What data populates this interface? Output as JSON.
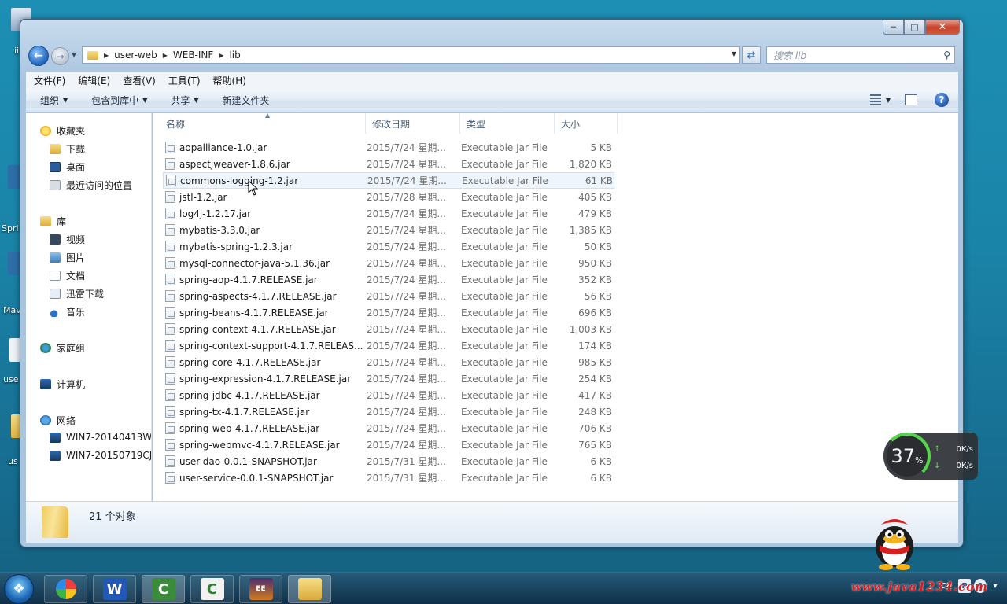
{
  "desktop": {
    "labels": [
      "ii",
      "Spri",
      "Mav",
      "use",
      "us"
    ]
  },
  "address": {
    "parts": [
      "user-web",
      "WEB-INF",
      "lib"
    ],
    "search_placeholder": "搜索 lib"
  },
  "menu": [
    "文件(F)",
    "编辑(E)",
    "查看(V)",
    "工具(T)",
    "帮助(H)"
  ],
  "toolbar": {
    "organize": "组织",
    "include_library": "包含到库中",
    "share": "共享",
    "new_folder": "新建文件夹"
  },
  "nav": {
    "favorites": "收藏夹",
    "favorites_items": [
      "下载",
      "桌面",
      "最近访问的位置"
    ],
    "libraries": "库",
    "library_items": [
      "视频",
      "图片",
      "文档",
      "迅雷下载",
      "音乐"
    ],
    "homegroup": "家庭组",
    "computer": "计算机",
    "network": "网络",
    "network_items": [
      "WIN7-20140413W",
      "WIN7-20150719CJ"
    ]
  },
  "columns": [
    "名称",
    "修改日期",
    "类型",
    "大小"
  ],
  "files": [
    {
      "name": "aopalliance-1.0.jar",
      "date": "2015/7/24 星期...",
      "type": "Executable Jar File",
      "size": "5 KB"
    },
    {
      "name": "aspectjweaver-1.8.6.jar",
      "date": "2015/7/24 星期...",
      "type": "Executable Jar File",
      "size": "1,820 KB"
    },
    {
      "name": "commons-logging-1.2.jar",
      "date": "2015/7/24 星期...",
      "type": "Executable Jar File",
      "size": "61 KB"
    },
    {
      "name": "jstl-1.2.jar",
      "date": "2015/7/28 星期...",
      "type": "Executable Jar File",
      "size": "405 KB"
    },
    {
      "name": "log4j-1.2.17.jar",
      "date": "2015/7/24 星期...",
      "type": "Executable Jar File",
      "size": "479 KB"
    },
    {
      "name": "mybatis-3.3.0.jar",
      "date": "2015/7/24 星期...",
      "type": "Executable Jar File",
      "size": "1,385 KB"
    },
    {
      "name": "mybatis-spring-1.2.3.jar",
      "date": "2015/7/24 星期...",
      "type": "Executable Jar File",
      "size": "50 KB"
    },
    {
      "name": "mysql-connector-java-5.1.36.jar",
      "date": "2015/7/24 星期...",
      "type": "Executable Jar File",
      "size": "950 KB"
    },
    {
      "name": "spring-aop-4.1.7.RELEASE.jar",
      "date": "2015/7/24 星期...",
      "type": "Executable Jar File",
      "size": "352 KB"
    },
    {
      "name": "spring-aspects-4.1.7.RELEASE.jar",
      "date": "2015/7/24 星期...",
      "type": "Executable Jar File",
      "size": "56 KB"
    },
    {
      "name": "spring-beans-4.1.7.RELEASE.jar",
      "date": "2015/7/24 星期...",
      "type": "Executable Jar File",
      "size": "696 KB"
    },
    {
      "name": "spring-context-4.1.7.RELEASE.jar",
      "date": "2015/7/24 星期...",
      "type": "Executable Jar File",
      "size": "1,003 KB"
    },
    {
      "name": "spring-context-support-4.1.7.RELEAS...",
      "date": "2015/7/24 星期...",
      "type": "Executable Jar File",
      "size": "174 KB"
    },
    {
      "name": "spring-core-4.1.7.RELEASE.jar",
      "date": "2015/7/24 星期...",
      "type": "Executable Jar File",
      "size": "985 KB"
    },
    {
      "name": "spring-expression-4.1.7.RELEASE.jar",
      "date": "2015/7/24 星期...",
      "type": "Executable Jar File",
      "size": "254 KB"
    },
    {
      "name": "spring-jdbc-4.1.7.RELEASE.jar",
      "date": "2015/7/24 星期...",
      "type": "Executable Jar File",
      "size": "417 KB"
    },
    {
      "name": "spring-tx-4.1.7.RELEASE.jar",
      "date": "2015/7/24 星期...",
      "type": "Executable Jar File",
      "size": "248 KB"
    },
    {
      "name": "spring-web-4.1.7.RELEASE.jar",
      "date": "2015/7/24 星期...",
      "type": "Executable Jar File",
      "size": "706 KB"
    },
    {
      "name": "spring-webmvc-4.1.7.RELEASE.jar",
      "date": "2015/7/24 星期...",
      "type": "Executable Jar File",
      "size": "765 KB"
    },
    {
      "name": "user-dao-0.0.1-SNAPSHOT.jar",
      "date": "2015/7/31 星期...",
      "type": "Executable Jar File",
      "size": "6 KB"
    },
    {
      "name": "user-service-0.0.1-SNAPSHOT.jar",
      "date": "2015/7/31 星期...",
      "type": "Executable Jar File",
      "size": "6 KB"
    }
  ],
  "status": {
    "count": "21 个对象"
  },
  "speed_widget": {
    "percent": "37",
    "percent_sign": "%",
    "up": "0K/s",
    "down": "0K/s"
  },
  "taskbar": {
    "apps": [
      "windows-start",
      "pinwheel-app",
      "word",
      "camtasia-recorder",
      "camtasia-studio",
      "java-ee-ide",
      "explorer"
    ],
    "tray": [
      "CH",
      "P",
      "?"
    ],
    "watermark": "www.java1234.com"
  },
  "colors": {
    "desktop": "#1a84a8",
    "selection_hover": "#eef5fd",
    "watermark": "#e11b1b"
  }
}
